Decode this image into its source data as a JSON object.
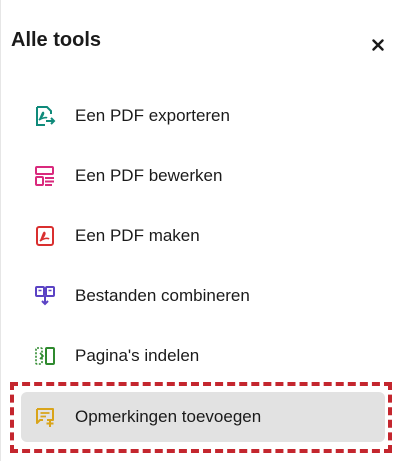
{
  "panel": {
    "title": "Alle tools",
    "close_icon": "close-icon"
  },
  "tools": [
    {
      "label": "Een PDF exporteren",
      "icon": "export-pdf-icon",
      "color": "#0f8a7a"
    },
    {
      "label": "Een PDF bewerken",
      "icon": "edit-pdf-icon",
      "color": "#d9297d"
    },
    {
      "label": "Een PDF maken",
      "icon": "create-pdf-icon",
      "color": "#d92f2f"
    },
    {
      "label": "Bestanden combineren",
      "icon": "combine-files-icon",
      "color": "#5b43c4"
    },
    {
      "label": "Pagina's indelen",
      "icon": "organize-pages-icon",
      "color": "#2f8a2f"
    },
    {
      "label": "Opmerkingen toevoegen",
      "icon": "comment-icon",
      "color": "#d9a41a",
      "active": true
    }
  ],
  "colors": {
    "highlight": "#c4262e",
    "active_bg": "#e2e2e2"
  }
}
